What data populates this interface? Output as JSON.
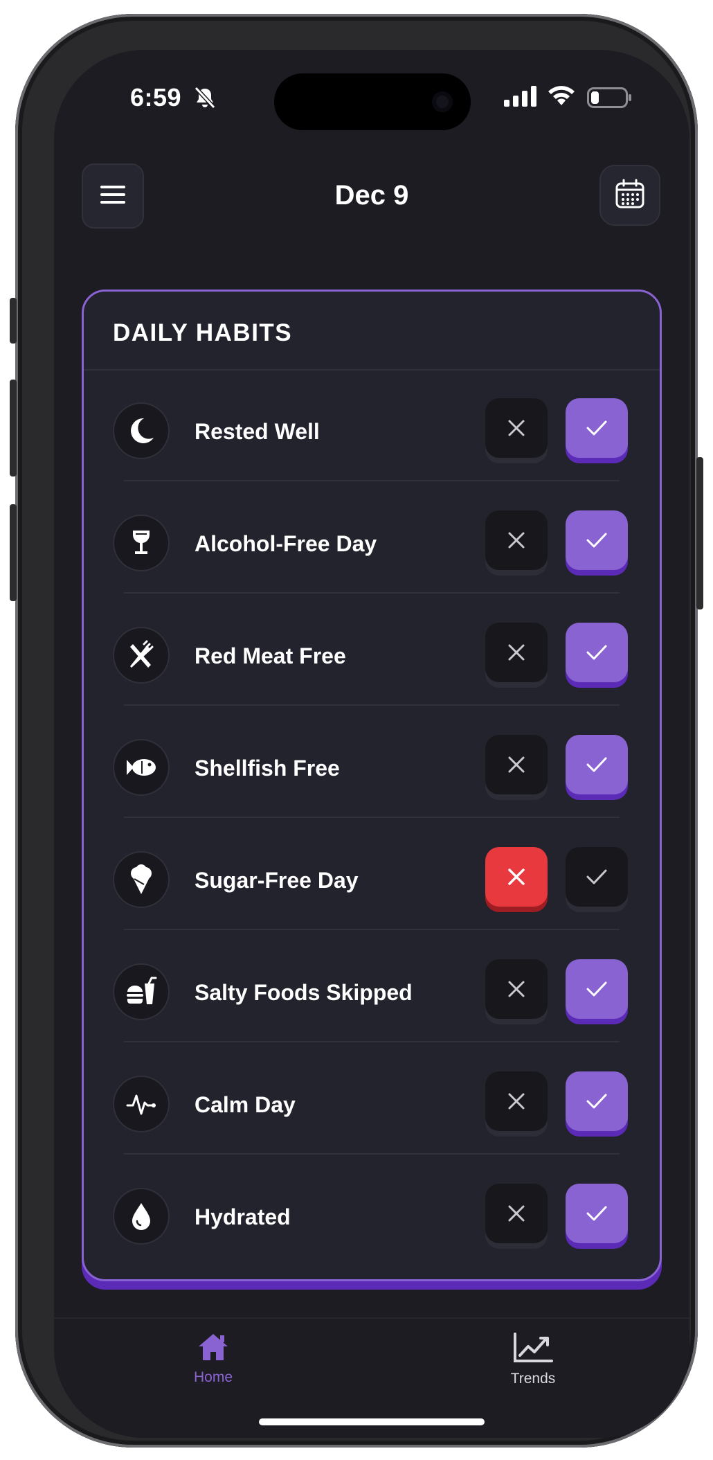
{
  "status_bar": {
    "time": "6:59",
    "icons": [
      "bell-slash-icon",
      "cellular-signal-icon",
      "wifi-icon",
      "battery-icon"
    ]
  },
  "header": {
    "title": "Dec 9",
    "menu_icon": "menu-icon",
    "calendar_icon": "calendar-icon"
  },
  "card": {
    "title": "DAILY HABITS",
    "habits": [
      {
        "label": "Rested Well",
        "icon": "moon-icon",
        "state": "yes"
      },
      {
        "label": "Alcohol-Free Day",
        "icon": "wine-glass-icon",
        "state": "yes"
      },
      {
        "label": "Red Meat Free",
        "icon": "utensils-icon",
        "state": "yes"
      },
      {
        "label": "Shellfish Free",
        "icon": "fish-icon",
        "state": "yes"
      },
      {
        "label": "Sugar-Free Day",
        "icon": "ice-cream-icon",
        "state": "no"
      },
      {
        "label": "Salty Foods Skipped",
        "icon": "burger-soda-icon",
        "state": "yes"
      },
      {
        "label": "Calm Day",
        "icon": "heartbeat-icon",
        "state": "yes"
      },
      {
        "label": "Hydrated",
        "icon": "water-drop-icon",
        "state": "yes"
      }
    ]
  },
  "tabs": [
    {
      "label": "Home",
      "icon": "home-icon",
      "active": true
    },
    {
      "label": "Trends",
      "icon": "chart-line-icon",
      "active": false
    }
  ],
  "colors": {
    "accent": "#8a63d2",
    "accent_shadow": "#5b2bb8",
    "negative": "#e8393f",
    "background": "#1c1c22",
    "card": "#23232d"
  }
}
